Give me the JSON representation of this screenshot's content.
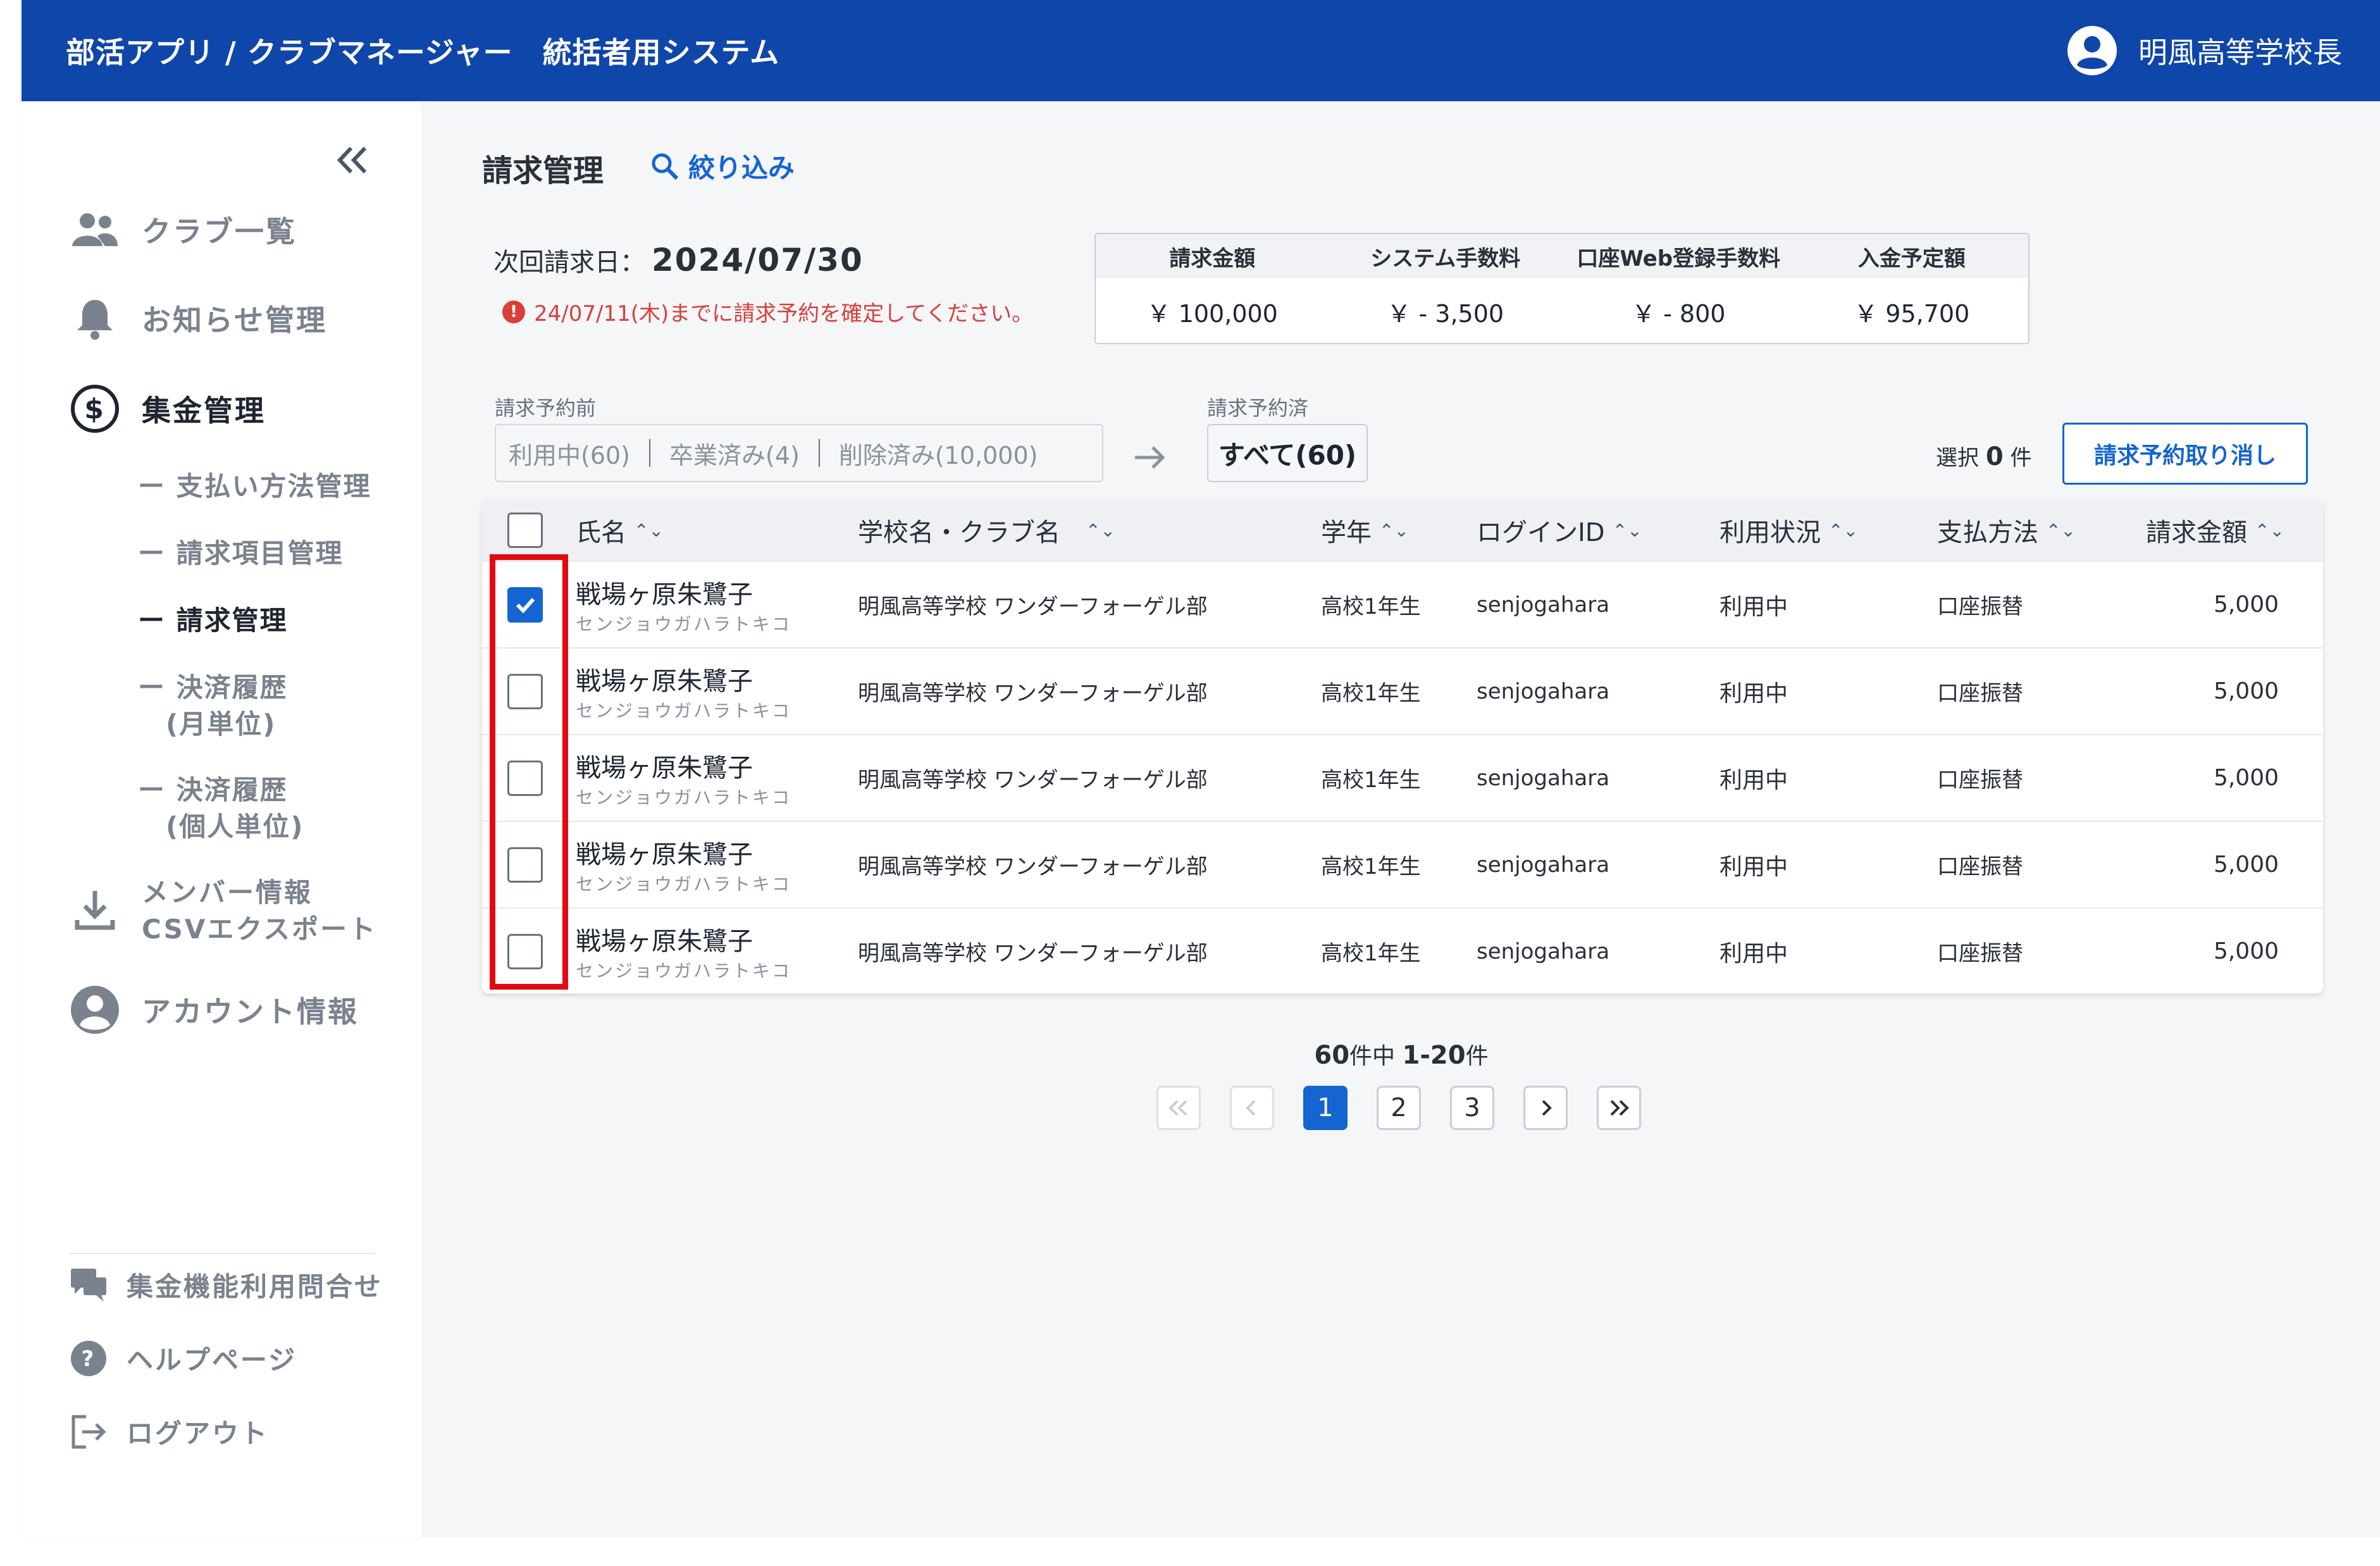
{
  "header": {
    "title": "部活アプリ / クラブマネージャー　統括者用システム",
    "user_name": "明風高等学校長"
  },
  "sidebar": {
    "collapse_label": "«",
    "items": [
      {
        "label": "クラブ一覧",
        "icon": "people-icon"
      },
      {
        "label": "お知らせ管理",
        "icon": "bell-icon"
      },
      {
        "label": "集金管理",
        "icon": "dollar-icon"
      }
    ],
    "sub_items": [
      {
        "label": "ー 支払い方法管理"
      },
      {
        "label": "ー 請求項目管理"
      },
      {
        "label": "ー 請求管理"
      },
      {
        "label": "ー 決済履歴",
        "label2": "(月単位)"
      },
      {
        "label": "ー 決済履歴",
        "label2": "(個人単位)"
      }
    ],
    "export": {
      "line1": "メンバー情報",
      "line2": "CSVエクスポート"
    },
    "account": "アカウント情報",
    "bottom": [
      {
        "label": "集金機能利用問合せ",
        "icon": "chat-icon"
      },
      {
        "label": "ヘルプページ",
        "icon": "help-icon"
      },
      {
        "label": "ログアウト",
        "icon": "logout-icon"
      }
    ]
  },
  "main": {
    "title": "請求管理",
    "filter_label": "絞り込み",
    "next_billing_label": "次回請求日：",
    "next_billing_date": "2024/07/30",
    "warning": "24/07/11(木)までに請求予約を確定してください。",
    "summary": {
      "headers": [
        "請求金額",
        "システム手数料",
        "口座Web登録手数料",
        "入金予定額"
      ],
      "values": [
        "￥ 100,000",
        "￥ - 3,500",
        "￥ - 800",
        "￥ 95,700"
      ]
    },
    "before_label": "請求予約前",
    "after_label": "請求予約済",
    "segments": [
      "利用中(60)",
      "卒業済み(4)",
      "削除済み(10,000)"
    ],
    "all_label": "すべて(60)",
    "selected_label": "選択",
    "selected_count": "0",
    "selected_unit": "件",
    "cancel_button": "請求予約取り消し",
    "table": {
      "headers": [
        "氏名",
        "学校名・クラブ名",
        "学年",
        "ログインID",
        "利用状況",
        "支払方法",
        "請求金額"
      ],
      "rows": [
        {
          "name": "戦場ヶ原朱鷺子",
          "kana": "センジョウガハラトキコ",
          "club": "明風高等学校 ワンダーフォーゲル部",
          "grade": "高校1年生",
          "login": "senjogahara",
          "status": "利用中",
          "method": "口座振替",
          "amount": "5,000",
          "checked": true
        },
        {
          "name": "戦場ヶ原朱鷺子",
          "kana": "センジョウガハラトキコ",
          "club": "明風高等学校 ワンダーフォーゲル部",
          "grade": "高校1年生",
          "login": "senjogahara",
          "status": "利用中",
          "method": "口座振替",
          "amount": "5,000",
          "checked": false
        },
        {
          "name": "戦場ヶ原朱鷺子",
          "kana": "センジョウガハラトキコ",
          "club": "明風高等学校 ワンダーフォーゲル部",
          "grade": "高校1年生",
          "login": "senjogahara",
          "status": "利用中",
          "method": "口座振替",
          "amount": "5,000",
          "checked": false
        },
        {
          "name": "戦場ヶ原朱鷺子",
          "kana": "センジョウガハラトキコ",
          "club": "明風高等学校 ワンダーフォーゲル部",
          "grade": "高校1年生",
          "login": "senjogahara",
          "status": "利用中",
          "method": "口座振替",
          "amount": "5,000",
          "checked": false
        },
        {
          "name": "戦場ヶ原朱鷺子",
          "kana": "センジョウガハラトキコ",
          "club": "明風高等学校 ワンダーフォーゲル部",
          "grade": "高校1年生",
          "login": "senjogahara",
          "status": "利用中",
          "method": "口座振替",
          "amount": "5,000",
          "checked": false
        }
      ]
    },
    "pagination": {
      "total": "60",
      "total_unit": "件中",
      "range": "1-20",
      "range_unit": "件",
      "pages": [
        "1",
        "2",
        "3"
      ],
      "current": "1"
    }
  },
  "colors": {
    "header_bg": "#0f46a9",
    "accent": "#1464d2",
    "warning": "#d93f3b",
    "highlight_box": "#e20a12"
  }
}
